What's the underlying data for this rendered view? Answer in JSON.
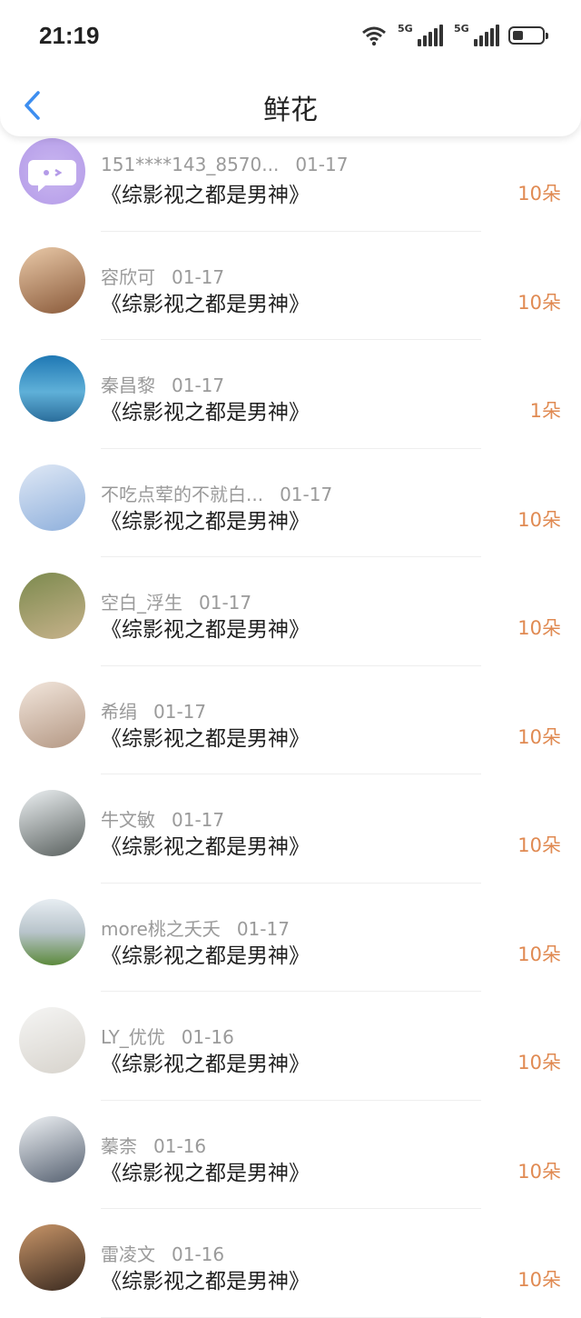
{
  "status": {
    "time": "21:19",
    "network1": "5G",
    "network2": "5G",
    "battery_level": 0.35
  },
  "header": {
    "title": "鲜花"
  },
  "colors": {
    "accent": "#3d8ef0",
    "count": "#e08a52"
  },
  "items": [
    {
      "name": "151****143_8570...",
      "date": "01-17",
      "book": "《综影视之都是男神》",
      "count": "10朵"
    },
    {
      "name": "容欣可",
      "date": "01-17",
      "book": "《综影视之都是男神》",
      "count": "10朵"
    },
    {
      "name": "秦昌黎",
      "date": "01-17",
      "book": "《综影视之都是男神》",
      "count": "1朵"
    },
    {
      "name": "不吃点荤的不就白...",
      "date": "01-17",
      "book": "《综影视之都是男神》",
      "count": "10朵"
    },
    {
      "name": "空白_浮生",
      "date": "01-17",
      "book": "《综影视之都是男神》",
      "count": "10朵"
    },
    {
      "name": "希绢",
      "date": "01-17",
      "book": "《综影视之都是男神》",
      "count": "10朵"
    },
    {
      "name": "牛文敏",
      "date": "01-17",
      "book": "《综影视之都是男神》",
      "count": "10朵"
    },
    {
      "name": "more桃之夭夭",
      "date": "01-17",
      "book": "《综影视之都是男神》",
      "count": "10朵"
    },
    {
      "name": "LY_优优",
      "date": "01-16",
      "book": "《综影视之都是男神》",
      "count": "10朵"
    },
    {
      "name": "蓁柰",
      "date": "01-16",
      "book": "《综影视之都是男神》",
      "count": "10朵"
    },
    {
      "name": "雷凌文",
      "date": "01-16",
      "book": "《综影视之都是男神》",
      "count": "10朵"
    }
  ]
}
